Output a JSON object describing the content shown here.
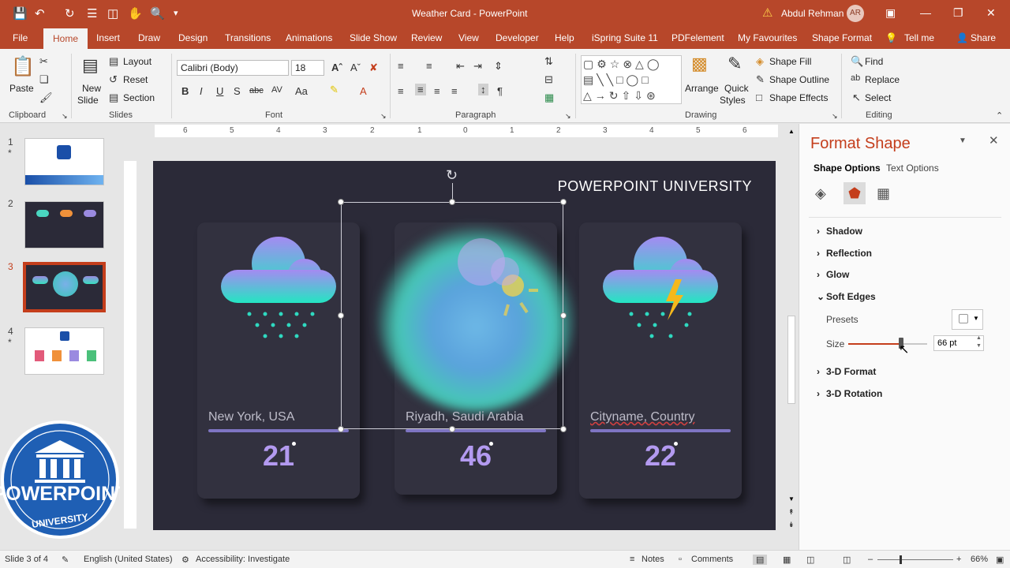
{
  "titlebar": {
    "doc_title": "Weather Card  -  PowerPoint",
    "user_name": "Abdul Rehman",
    "avatar_initials": "AR"
  },
  "tabs": [
    "File",
    "Home",
    "Insert",
    "Draw",
    "Design",
    "Transitions",
    "Animations",
    "Slide Show",
    "Review",
    "View",
    "Developer",
    "Help",
    "iSpring Suite 11",
    "PDFelement",
    "My Favourites",
    "Shape Format"
  ],
  "tell_me": "Tell me",
  "share": "Share",
  "ribbon": {
    "clipboard": {
      "label": "Clipboard",
      "paste": "Paste"
    },
    "slides": {
      "label": "Slides",
      "new_slide": "New",
      "new_slide2": "Slide",
      "layout": "Layout",
      "reset": "Reset",
      "section": "Section"
    },
    "font": {
      "label": "Font",
      "font_name": "Calibri (Body)",
      "font_size": "18"
    },
    "paragraph": {
      "label": "Paragraph"
    },
    "drawing": {
      "label": "Drawing",
      "arrange": "Arrange",
      "quick_styles": "Quick",
      "quick_styles2": "Styles",
      "shape_fill": "Shape Fill",
      "shape_outline": "Shape Outline",
      "shape_effects": "Shape Effects"
    },
    "editing": {
      "label": "Editing",
      "find": "Find",
      "replace": "Replace",
      "select": "Select"
    }
  },
  "thumbnails": [
    {
      "num": "1",
      "star": "*"
    },
    {
      "num": "2",
      "star": ""
    },
    {
      "num": "3",
      "star": ""
    },
    {
      "num": "4",
      "star": "*"
    }
  ],
  "slide": {
    "brand": "POWERPOINT UNIVERSITY",
    "cards": [
      {
        "city": "New York, USA",
        "temp": "21"
      },
      {
        "city": "Riyadh, Saudi Arabia",
        "temp": "46"
      },
      {
        "city": "Cityname, Country",
        "temp": "22"
      }
    ]
  },
  "ruler_h": [
    "6",
    "5",
    "4",
    "3",
    "2",
    "1",
    "0",
    "1",
    "2",
    "3",
    "4",
    "5",
    "6"
  ],
  "pane": {
    "title": "Format Shape",
    "tab_shape": "Shape Options",
    "tab_text": "Text Options",
    "sections": [
      "Shadow",
      "Reflection",
      "Glow",
      "Soft Edges",
      "3-D Format",
      "3-D Rotation"
    ],
    "presets_label": "Presets",
    "size_label": "Size",
    "size_value": "66 pt"
  },
  "logo": {
    "line1": "POWERPOINT",
    "line2": "UNIVERSITY"
  },
  "status": {
    "slide_of": "Slide 3 of 4",
    "language": "English (United States)",
    "accessibility": "Accessibility: Investigate",
    "notes": "Notes",
    "comments": "Comments",
    "zoom": "66%"
  },
  "colors": {
    "accent": "#b7472a",
    "slide_bg": "#2b2a38",
    "card_bg": "#32313f",
    "temp": "#b39af0"
  }
}
